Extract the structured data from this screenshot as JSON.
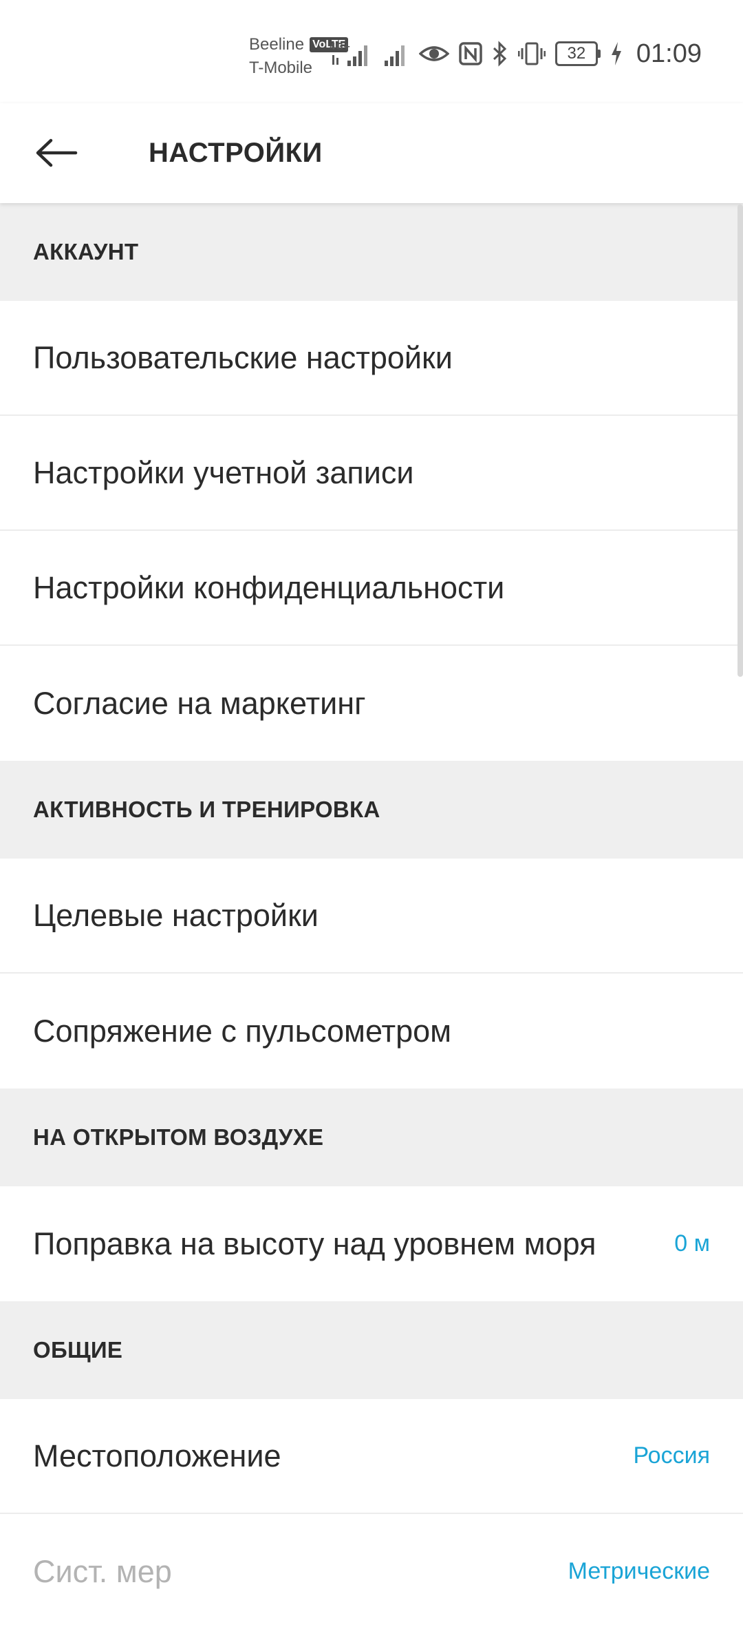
{
  "status_bar": {
    "carrier_1": "Beeline",
    "volte": "VoLTE",
    "carrier_2": "T-Mobile",
    "network_type": "4G+",
    "battery_level": "32",
    "time": "01:09"
  },
  "app_bar": {
    "title": "НАСТРОЙКИ"
  },
  "sections": {
    "account": {
      "header": "АККАУНТ",
      "items": [
        {
          "label": "Пользовательские настройки"
        },
        {
          "label": "Настройки учетной записи"
        },
        {
          "label": "Настройки конфиденциальности"
        },
        {
          "label": "Согласие на маркетинг"
        }
      ]
    },
    "activity": {
      "header": "АКТИВНОСТЬ И ТРЕНИРОВКА",
      "items": [
        {
          "label": "Целевые настройки"
        },
        {
          "label": "Сопряжение с пульсометром"
        }
      ]
    },
    "outdoors": {
      "header": "НА ОТКРЫТОМ ВОЗДУХЕ",
      "items": [
        {
          "label": "Поправка на высоту над уровнем моря",
          "value": "0 м"
        }
      ]
    },
    "general": {
      "header": "ОБЩИЕ",
      "items": [
        {
          "label": "Местоположение",
          "value": "Россия"
        },
        {
          "label": "Сист. мер",
          "value": "Метрические"
        }
      ]
    }
  },
  "colors": {
    "accent": "#1aa4d6",
    "section_bg": "#efefef",
    "text": "#2b2b2b"
  }
}
